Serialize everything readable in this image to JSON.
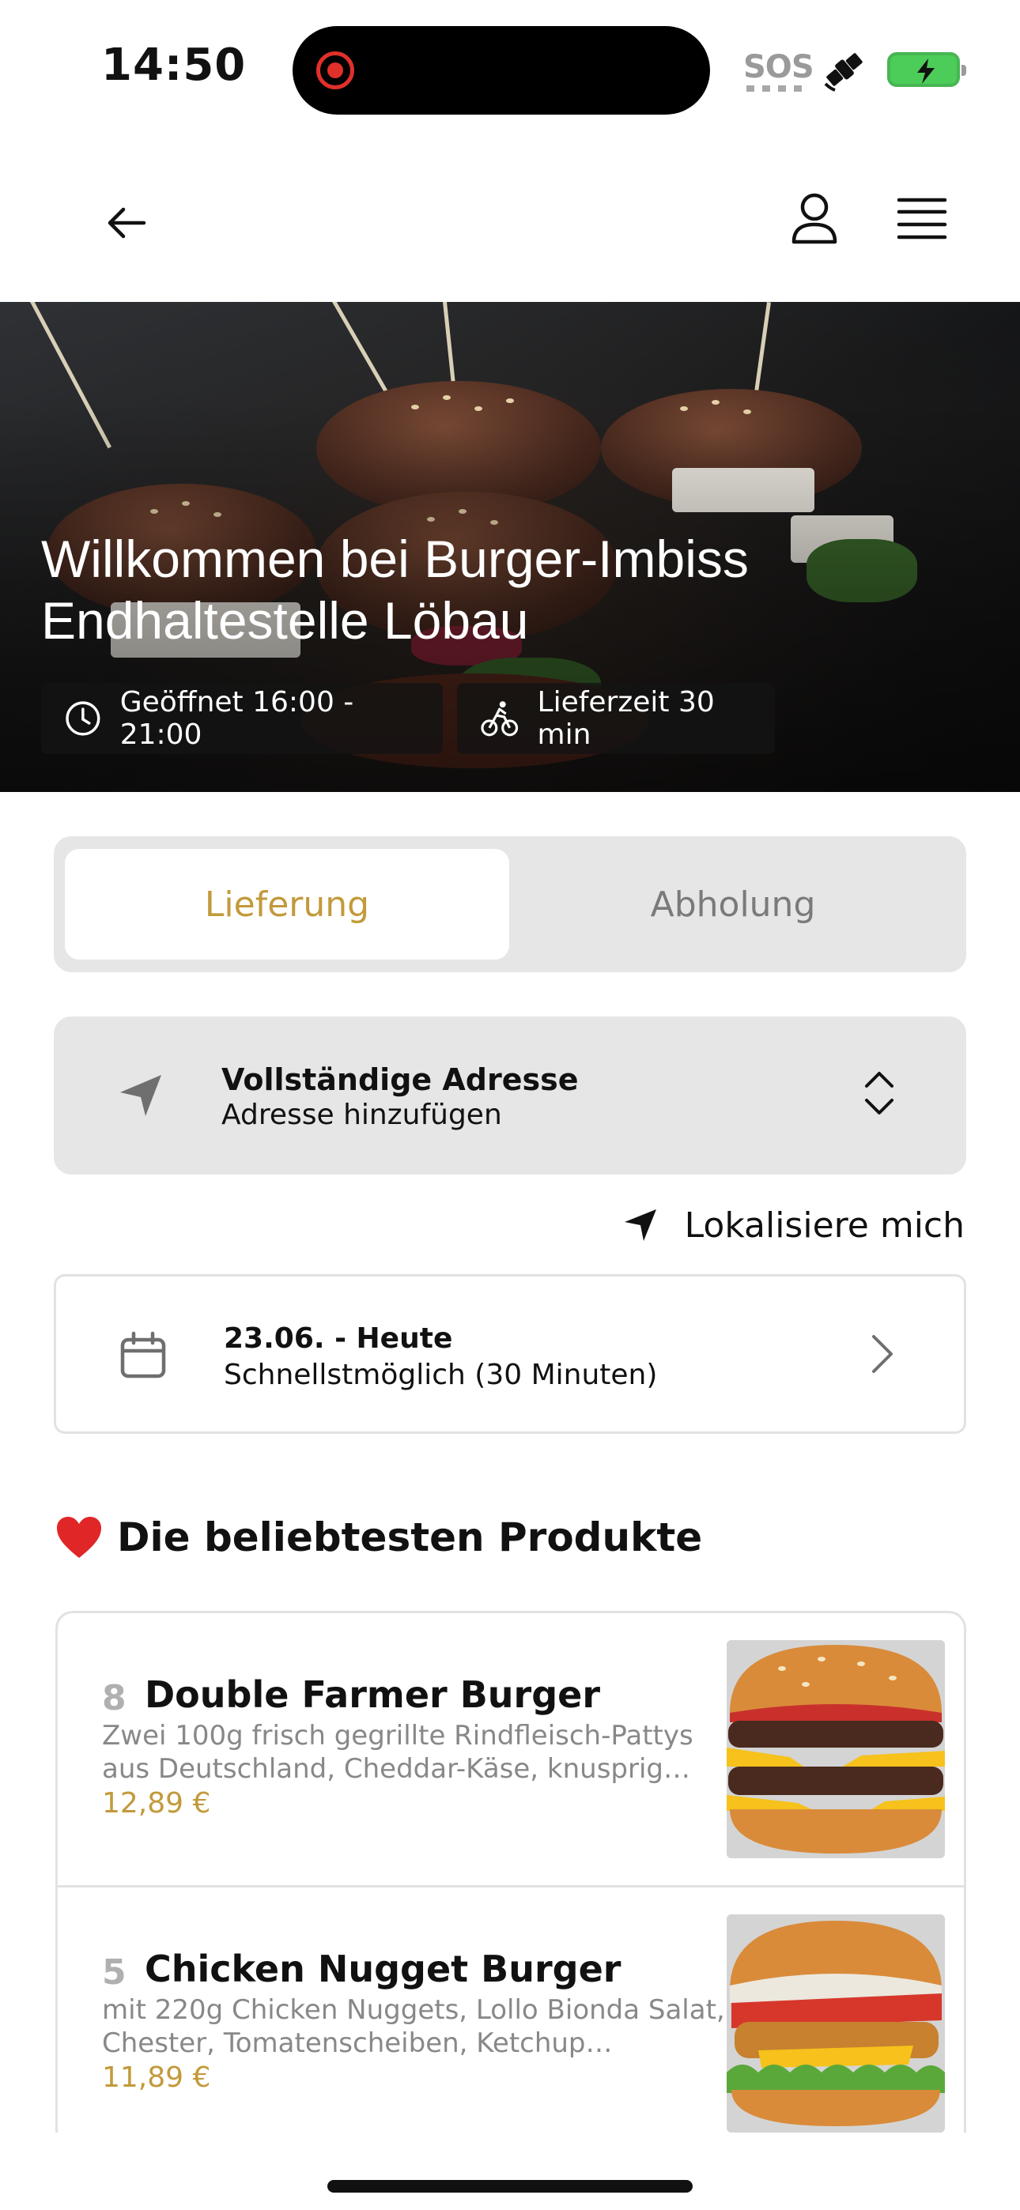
{
  "status_bar": {
    "time": "14:50",
    "sos": "SOS"
  },
  "nav": {
    "back_icon": "arrow-left",
    "account_icon": "user",
    "menu_icon": "hamburger-menu"
  },
  "hero": {
    "title_line1": "Willkommen bei Burger-Imbiss",
    "title_line2": "Endhaltestelle Löbau",
    "open_hours": "Geöffnet 16:00 - 21:00",
    "delivery_time": "Lieferzeit 30 min"
  },
  "order_mode": {
    "options": [
      "Lieferung",
      "Abholung"
    ],
    "selected": "Lieferung",
    "accent_color": "#c29a3a"
  },
  "address": {
    "title": "Vollständige Adresse",
    "subtitle": "Adresse hinzufügen"
  },
  "locate": {
    "label": "Lokalisiere mich"
  },
  "schedule": {
    "date": "23.06. - Heute",
    "time": "Schnellstmöglich (30 Minuten)"
  },
  "popular": {
    "title": "Die beliebtesten Produkte",
    "products": [
      {
        "rank": "8",
        "name": "Double Farmer Burger",
        "description": "Zwei 100g frisch gegrillte Rindfleisch-Pattys aus Deutschland, Cheddar-Käse, knusprig…",
        "price": "12,89 €"
      },
      {
        "rank": "5",
        "name": "Chicken Nugget Burger",
        "description": "mit 220g Chicken Nuggets, Lollo Bionda Salat, Chester, Tomatenscheiben, Ketchup…",
        "price": "11,89 €"
      }
    ]
  }
}
